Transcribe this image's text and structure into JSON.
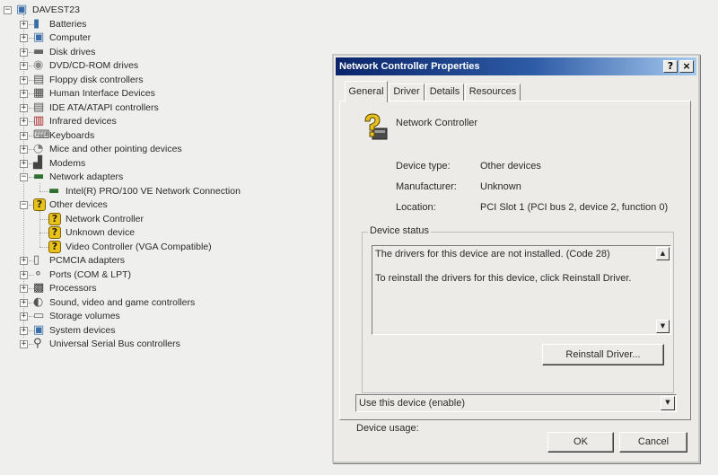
{
  "tree": {
    "root": "DAVEST23",
    "categories": [
      {
        "label": "Batteries",
        "icon": "battery-icon",
        "expanded": false
      },
      {
        "label": "Computer",
        "icon": "computer-icon",
        "expanded": false
      },
      {
        "label": "Disk drives",
        "icon": "disk-drive-icon",
        "expanded": false
      },
      {
        "label": "DVD/CD-ROM drives",
        "icon": "cdrom-icon",
        "expanded": false
      },
      {
        "label": "Floppy disk controllers",
        "icon": "floppy-controller-icon",
        "expanded": false
      },
      {
        "label": "Human Interface Devices",
        "icon": "hid-icon",
        "expanded": false
      },
      {
        "label": "IDE ATA/ATAPI controllers",
        "icon": "ide-controller-icon",
        "expanded": false
      },
      {
        "label": "Infrared devices",
        "icon": "infrared-icon",
        "expanded": false
      },
      {
        "label": "Keyboards",
        "icon": "keyboard-icon",
        "expanded": false
      },
      {
        "label": "Mice and other pointing devices",
        "icon": "mouse-icon",
        "expanded": false
      },
      {
        "label": "Modems",
        "icon": "modem-icon",
        "expanded": false
      },
      {
        "label": "Network adapters",
        "icon": "network-adapter-icon",
        "expanded": true,
        "children": [
          {
            "label": "Intel(R) PRO/100 VE Network Connection",
            "icon": "network-card-icon"
          }
        ]
      },
      {
        "label": "Other devices",
        "icon": "unknown-device-icon",
        "expanded": true,
        "children": [
          {
            "label": "Network Controller",
            "icon": "unknown-device-icon"
          },
          {
            "label": "Unknown device",
            "icon": "unknown-device-icon"
          },
          {
            "label": "Video Controller (VGA Compatible)",
            "icon": "unknown-device-icon"
          }
        ]
      },
      {
        "label": "PCMCIA adapters",
        "icon": "pcmcia-icon",
        "expanded": false
      },
      {
        "label": "Ports (COM & LPT)",
        "icon": "port-icon",
        "expanded": false
      },
      {
        "label": "Processors",
        "icon": "processor-icon",
        "expanded": false
      },
      {
        "label": "Sound, video and game controllers",
        "icon": "sound-icon",
        "expanded": false
      },
      {
        "label": "Storage volumes",
        "icon": "storage-volume-icon",
        "expanded": false
      },
      {
        "label": "System devices",
        "icon": "system-device-icon",
        "expanded": false
      },
      {
        "label": "Universal Serial Bus controllers",
        "icon": "usb-icon",
        "expanded": false
      }
    ]
  },
  "dialog": {
    "title": "Network Controller Properties",
    "help_glyph": "?",
    "close_glyph": "×",
    "tabs": [
      "General",
      "Driver",
      "Details",
      "Resources"
    ],
    "active_tab": "General",
    "device_name": "Network Controller",
    "device_type_label": "Device type:",
    "device_type_value": "Other devices",
    "manufacturer_label": "Manufacturer:",
    "manufacturer_value": "Unknown",
    "location_label": "Location:",
    "location_value": "PCI Slot 1 (PCI bus 2, device 2, function 0)",
    "status_legend": "Device status",
    "status_line1": "The drivers for this device are not installed. (Code 28)",
    "status_line2": "To reinstall the drivers for this device, click Reinstall Driver.",
    "reinstall_label": "Reinstall Driver...",
    "usage_label": "Device usage:",
    "usage_value": "Use this device (enable)",
    "ok_label": "OK",
    "cancel_label": "Cancel"
  },
  "colors": {
    "titlebar_start": "#0a246a",
    "titlebar_end": "#a6caf0",
    "warning_icon": "#e8c21c",
    "window_bg": "#ecebe8"
  }
}
